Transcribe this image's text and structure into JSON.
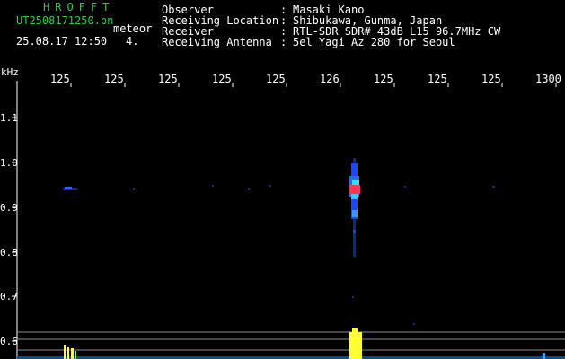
{
  "logo": {
    "brand": "HROFFT"
  },
  "file": {
    "name": "UT2508171250.pn",
    "mode": "meteor",
    "datetime": "25.08.17 12:50",
    "index": "4."
  },
  "header": {
    "rows": [
      {
        "label": "Observer",
        "sep": ":",
        "value": "Masaki Kano"
      },
      {
        "label": "Receiving Location",
        "sep": ":",
        "value": "Shibukawa, Gunma, Japan"
      },
      {
        "label": "Receiver",
        "sep": ":",
        "value": "RTL-SDR SDR# 43dB L15 96.7MHz CW"
      },
      {
        "label": "Receiving Antenna",
        "sep": ":",
        "value": "5el Yagi Az 280 for Seoul"
      }
    ]
  },
  "axes": {
    "y_unit": "kHz",
    "x_ticks": [
      "125",
      "125",
      "125",
      "125",
      "125",
      "126",
      "125",
      "125",
      "125",
      "1300"
    ],
    "y_ticks": [
      "1.1",
      "1.0",
      "0.9",
      "0.8",
      "0.7",
      "0.6"
    ]
  },
  "colors": {
    "text_green": "#2ecc40",
    "text_white": "#ffffff",
    "meteor_core": "#ff3355",
    "meteor_body": "#2255ff",
    "spectrum_yellow": "#ffff33"
  }
}
